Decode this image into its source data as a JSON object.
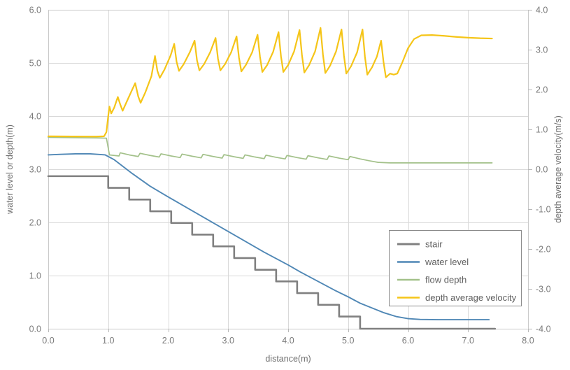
{
  "chart_data": {
    "type": "line",
    "title": "",
    "xlabel": "distance(m)",
    "ylabel": "water level or depth(m)",
    "y2label": "depth average velocity(m/s)",
    "xlim": [
      0.0,
      8.0
    ],
    "ylim": [
      0.0,
      6.0
    ],
    "y2lim": [
      -4.0,
      4.0
    ],
    "xticks": [
      "0.0",
      "1.0",
      "2.0",
      "3.0",
      "4.0",
      "5.0",
      "6.0",
      "7.0",
      "8.0"
    ],
    "yticks": [
      "0.0",
      "1.0",
      "2.0",
      "3.0",
      "4.0",
      "5.0",
      "6.0"
    ],
    "y2ticks": [
      "-4.0",
      "-3.0",
      "-2.0",
      "-1.0",
      "0.0",
      "1.0",
      "2.0",
      "3.0",
      "4.0"
    ],
    "grid": true,
    "legend_position": "center-right",
    "colors": {
      "stair": "#808080",
      "water_level": "#4f87b5",
      "flow_depth": "#a3c18a",
      "depth_average_velocity": "#f5c518"
    },
    "series": [
      {
        "name": "stair",
        "axis": "left",
        "color": "#808080",
        "note": "step profile: flat crest at 2.87 m to x=1.0, then 13 descending steps of ~0.22 m rise and ~0.35 m tread down to 0.0 at x=5.5, then flat bed at 0.0 to x=7.45",
        "points": [
          [
            0.0,
            2.87
          ],
          [
            1.0,
            2.87
          ],
          [
            1.0,
            2.65
          ],
          [
            1.35,
            2.65
          ],
          [
            1.35,
            2.43
          ],
          [
            1.7,
            2.43
          ],
          [
            1.7,
            2.21
          ],
          [
            2.05,
            2.21
          ],
          [
            2.05,
            1.99
          ],
          [
            2.4,
            1.99
          ],
          [
            2.4,
            1.77
          ],
          [
            2.75,
            1.77
          ],
          [
            2.75,
            1.55
          ],
          [
            3.1,
            1.55
          ],
          [
            3.1,
            1.33
          ],
          [
            3.45,
            1.33
          ],
          [
            3.45,
            1.11
          ],
          [
            3.8,
            1.11
          ],
          [
            3.8,
            0.89
          ],
          [
            4.15,
            0.89
          ],
          [
            4.15,
            0.67
          ],
          [
            4.5,
            0.67
          ],
          [
            4.5,
            0.45
          ],
          [
            4.85,
            0.45
          ],
          [
            4.85,
            0.23
          ],
          [
            5.2,
            0.23
          ],
          [
            5.2,
            0.0
          ],
          [
            5.5,
            0.0
          ],
          [
            7.45,
            0.0
          ]
        ]
      },
      {
        "name": "water level",
        "axis": "left",
        "color": "#4f87b5",
        "note": "smooth descending free surface from 3.27 m, crest near 3.29 m at x=0.6, falling over the steps, flattening at 0.17 m beyond x=6.2",
        "points": [
          [
            0.0,
            3.27
          ],
          [
            0.2,
            3.28
          ],
          [
            0.45,
            3.29
          ],
          [
            0.7,
            3.29
          ],
          [
            0.95,
            3.27
          ],
          [
            1.1,
            3.18
          ],
          [
            1.25,
            3.05
          ],
          [
            1.4,
            2.92
          ],
          [
            1.55,
            2.8
          ],
          [
            1.7,
            2.68
          ],
          [
            1.85,
            2.58
          ],
          [
            2.0,
            2.48
          ],
          [
            2.2,
            2.35
          ],
          [
            2.4,
            2.22
          ],
          [
            2.6,
            2.09
          ],
          [
            2.8,
            1.96
          ],
          [
            3.0,
            1.83
          ],
          [
            3.2,
            1.7
          ],
          [
            3.4,
            1.57
          ],
          [
            3.6,
            1.44
          ],
          [
            3.8,
            1.32
          ],
          [
            4.0,
            1.2
          ],
          [
            4.2,
            1.07
          ],
          [
            4.4,
            0.95
          ],
          [
            4.6,
            0.83
          ],
          [
            4.8,
            0.71
          ],
          [
            5.0,
            0.6
          ],
          [
            5.2,
            0.48
          ],
          [
            5.4,
            0.39
          ],
          [
            5.6,
            0.3
          ],
          [
            5.8,
            0.23
          ],
          [
            6.0,
            0.19
          ],
          [
            6.2,
            0.175
          ],
          [
            6.5,
            0.17
          ],
          [
            7.0,
            0.17
          ],
          [
            7.35,
            0.17
          ]
        ]
      },
      {
        "name": "flow depth",
        "axis": "left",
        "color": "#a3c18a",
        "note": "plotted on left axis scale; flat near 3.60 to x=1.0, abrupt drop to 3.28, then sawtooth (one tooth per step) slowly decaying, flat at 3.12 beyond x=5.5",
        "points": [
          [
            0.0,
            3.6
          ],
          [
            0.4,
            3.595
          ],
          [
            0.8,
            3.59
          ],
          [
            0.97,
            3.585
          ],
          [
            1.0,
            3.4
          ],
          [
            1.02,
            3.27
          ],
          [
            1.1,
            3.26
          ],
          [
            1.18,
            3.25
          ],
          [
            1.2,
            3.31
          ],
          [
            1.35,
            3.27
          ],
          [
            1.5,
            3.24
          ],
          [
            1.53,
            3.3
          ],
          [
            1.7,
            3.26
          ],
          [
            1.85,
            3.23
          ],
          [
            1.88,
            3.29
          ],
          [
            2.05,
            3.25
          ],
          [
            2.2,
            3.22
          ],
          [
            2.23,
            3.285
          ],
          [
            2.4,
            3.245
          ],
          [
            2.55,
            3.215
          ],
          [
            2.58,
            3.28
          ],
          [
            2.75,
            3.24
          ],
          [
            2.9,
            3.21
          ],
          [
            2.93,
            3.275
          ],
          [
            3.1,
            3.235
          ],
          [
            3.25,
            3.205
          ],
          [
            3.28,
            3.27
          ],
          [
            3.45,
            3.23
          ],
          [
            3.6,
            3.2
          ],
          [
            3.63,
            3.265
          ],
          [
            3.8,
            3.225
          ],
          [
            3.95,
            3.195
          ],
          [
            3.98,
            3.26
          ],
          [
            4.15,
            3.22
          ],
          [
            4.3,
            3.19
          ],
          [
            4.33,
            3.255
          ],
          [
            4.5,
            3.215
          ],
          [
            4.65,
            3.185
          ],
          [
            4.68,
            3.25
          ],
          [
            4.85,
            3.21
          ],
          [
            5.0,
            3.18
          ],
          [
            5.03,
            3.24
          ],
          [
            5.2,
            3.195
          ],
          [
            5.35,
            3.16
          ],
          [
            5.5,
            3.13
          ],
          [
            5.7,
            3.12
          ],
          [
            6.0,
            3.12
          ],
          [
            6.5,
            3.12
          ],
          [
            7.0,
            3.12
          ],
          [
            7.4,
            3.12
          ]
        ]
      },
      {
        "name": "depth average velocity",
        "axis": "left_scale_shown",
        "color": "#f5c518",
        "note": "drawn against the left-axis pixel scale in this figure; flat near 3.62 to x=0.95, steep rise at the crest, then sawtooth peaks growing from ~4.3 to ~5.7 with troughs ~4.75-4.9, finally rising to a plateau ~5.52 after x=6.1 and easing to 5.46",
        "points": [
          [
            0.0,
            3.62
          ],
          [
            0.4,
            3.617
          ],
          [
            0.8,
            3.615
          ],
          [
            0.93,
            3.62
          ],
          [
            0.97,
            3.7
          ],
          [
            1.0,
            4.0
          ],
          [
            1.02,
            4.18
          ],
          [
            1.05,
            4.05
          ],
          [
            1.1,
            4.16
          ],
          [
            1.16,
            4.36
          ],
          [
            1.2,
            4.22
          ],
          [
            1.24,
            4.1
          ],
          [
            1.3,
            4.25
          ],
          [
            1.38,
            4.45
          ],
          [
            1.45,
            4.62
          ],
          [
            1.5,
            4.37
          ],
          [
            1.54,
            4.25
          ],
          [
            1.62,
            4.45
          ],
          [
            1.72,
            4.75
          ],
          [
            1.78,
            5.13
          ],
          [
            1.82,
            4.85
          ],
          [
            1.86,
            4.72
          ],
          [
            1.94,
            4.88
          ],
          [
            2.04,
            5.14
          ],
          [
            2.1,
            5.36
          ],
          [
            2.14,
            5.02
          ],
          [
            2.18,
            4.85
          ],
          [
            2.26,
            4.98
          ],
          [
            2.36,
            5.2
          ],
          [
            2.44,
            5.42
          ],
          [
            2.48,
            5.05
          ],
          [
            2.52,
            4.86
          ],
          [
            2.6,
            4.98
          ],
          [
            2.7,
            5.2
          ],
          [
            2.79,
            5.47
          ],
          [
            2.83,
            5.08
          ],
          [
            2.87,
            4.86
          ],
          [
            2.95,
            4.98
          ],
          [
            3.05,
            5.2
          ],
          [
            3.14,
            5.5
          ],
          [
            3.18,
            5.1
          ],
          [
            3.22,
            4.84
          ],
          [
            3.3,
            4.97
          ],
          [
            3.4,
            5.2
          ],
          [
            3.49,
            5.53
          ],
          [
            3.53,
            5.12
          ],
          [
            3.57,
            4.83
          ],
          [
            3.65,
            4.96
          ],
          [
            3.75,
            5.21
          ],
          [
            3.84,
            5.58
          ],
          [
            3.88,
            5.13
          ],
          [
            3.92,
            4.83
          ],
          [
            4.0,
            4.96
          ],
          [
            4.1,
            5.22
          ],
          [
            4.19,
            5.62
          ],
          [
            4.23,
            5.15
          ],
          [
            4.27,
            4.82
          ],
          [
            4.35,
            4.96
          ],
          [
            4.45,
            5.22
          ],
          [
            4.54,
            5.66
          ],
          [
            4.58,
            5.16
          ],
          [
            4.62,
            4.81
          ],
          [
            4.7,
            4.95
          ],
          [
            4.8,
            5.22
          ],
          [
            4.89,
            5.63
          ],
          [
            4.93,
            5.14
          ],
          [
            4.97,
            4.8
          ],
          [
            5.05,
            4.94
          ],
          [
            5.15,
            5.2
          ],
          [
            5.24,
            5.63
          ],
          [
            5.28,
            5.12
          ],
          [
            5.32,
            4.78
          ],
          [
            5.4,
            4.92
          ],
          [
            5.48,
            5.12
          ],
          [
            5.55,
            5.42
          ],
          [
            5.59,
            5.02
          ],
          [
            5.63,
            4.73
          ],
          [
            5.7,
            4.8
          ],
          [
            5.76,
            4.78
          ],
          [
            5.82,
            4.8
          ],
          [
            5.9,
            5.0
          ],
          [
            6.0,
            5.28
          ],
          [
            6.1,
            5.45
          ],
          [
            6.22,
            5.52
          ],
          [
            6.4,
            5.525
          ],
          [
            6.6,
            5.51
          ],
          [
            6.8,
            5.49
          ],
          [
            7.0,
            5.475
          ],
          [
            7.2,
            5.465
          ],
          [
            7.4,
            5.46
          ]
        ]
      }
    ]
  },
  "legend": {
    "items": [
      {
        "label": "stair",
        "color": "#808080"
      },
      {
        "label": "water level",
        "color": "#4f87b5"
      },
      {
        "label": "flow depth",
        "color": "#a3c18a"
      },
      {
        "label": "depth average velocity",
        "color": "#f5c518"
      }
    ]
  }
}
